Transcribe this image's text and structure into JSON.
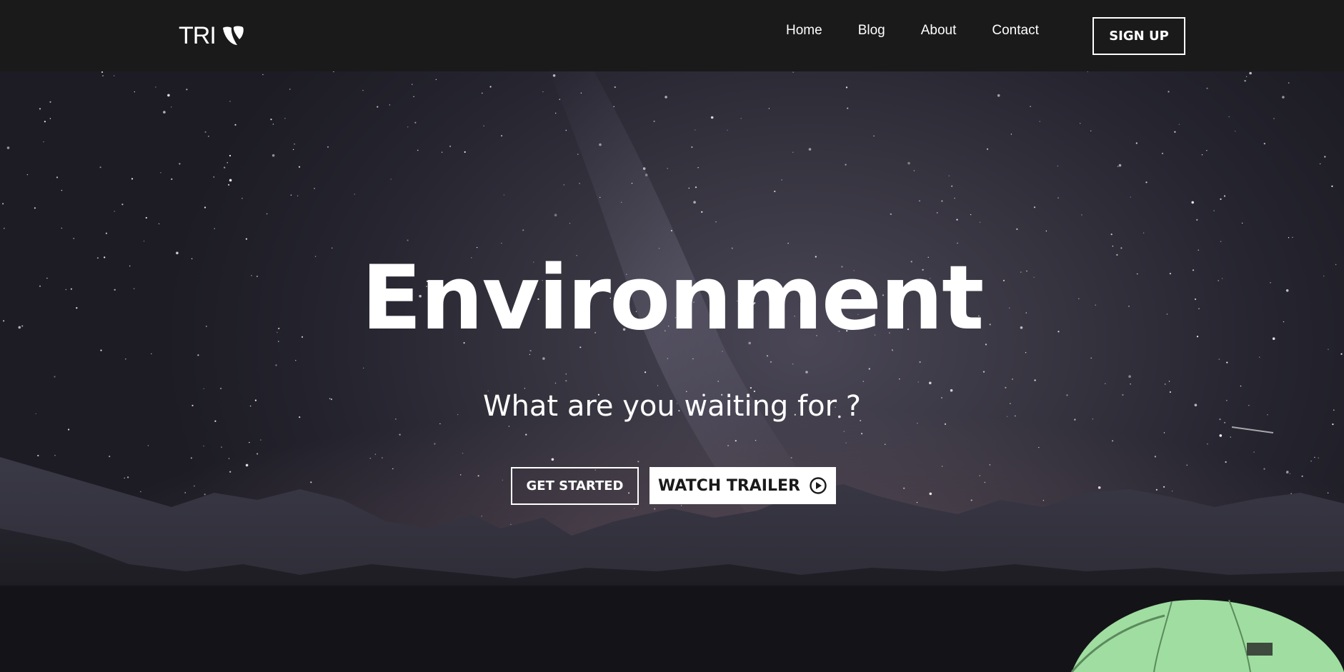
{
  "brand": {
    "name": "TRI",
    "logo_icon": "typo3-icon"
  },
  "nav": {
    "items": [
      {
        "label": "Home"
      },
      {
        "label": "Blog"
      },
      {
        "label": "About"
      },
      {
        "label": "Contact"
      }
    ],
    "signup_label": "SIGN UP"
  },
  "hero": {
    "title": "Environment",
    "subtitle": "What are you waiting for ?",
    "primary_cta": "GET STARTED",
    "secondary_cta": "WATCH TRAILER",
    "secondary_cta_icon": "play-circle-icon",
    "background": "night-sky-mountains-tent"
  },
  "colors": {
    "header_bg": "#1b1a1b",
    "text": "#ffffff",
    "tent": "#9fdea0"
  }
}
